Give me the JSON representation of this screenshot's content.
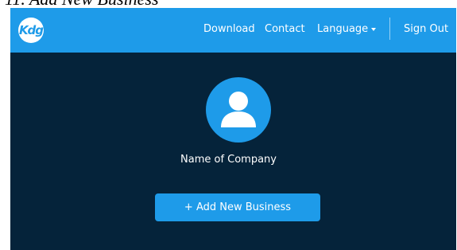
{
  "document": {
    "heading": "11. Add New Business"
  },
  "app": {
    "logo_text": "Kdg"
  },
  "navbar": {
    "download_label": "Download",
    "contact_label": "Contact",
    "language_label": "Language",
    "signout_label": "Sign Out"
  },
  "profile": {
    "avatar_icon": "user-icon",
    "company_name": "Name of Company"
  },
  "actions": {
    "add_business_label": "+ Add New Business"
  },
  "colors": {
    "brand_blue": "#1e9be9",
    "background_navy": "#05233a",
    "text_white": "#ffffff"
  }
}
